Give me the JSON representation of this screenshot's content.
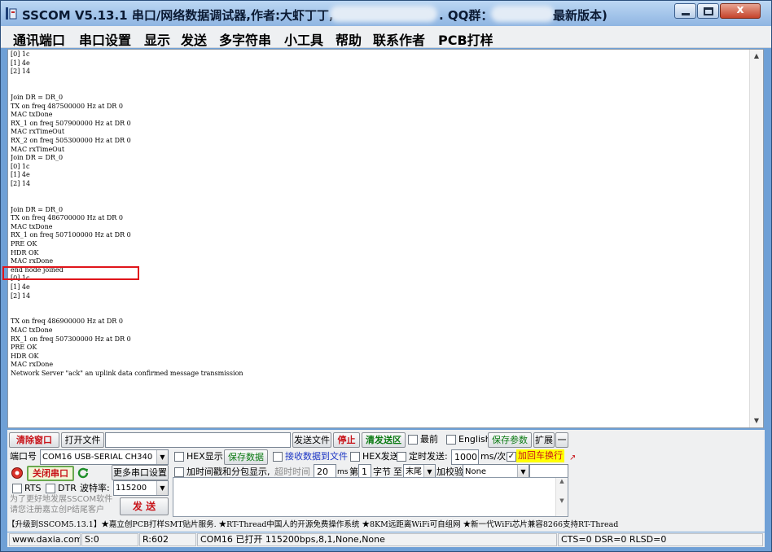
{
  "window": {
    "title": "SSCOM V5.13.1 串口/网络数据调试器,作者:大虾丁丁,",
    "title_qq": ". QQ群：",
    "title_tail": "最新版本)",
    "close_glyph": "x"
  },
  "menu": [
    "通讯端口",
    "串口设置",
    "显示",
    "发送",
    "多字符串",
    "小工具",
    "帮助",
    "联系作者",
    "PCB打样"
  ],
  "receive_log": [
    "[0] 1c",
    "[1] 4e",
    "[2] 14",
    "",
    "",
    "Join DR = DR_0",
    "TX on freq 487500000 Hz at DR 0",
    "MAC txDone",
    "RX_1 on freq 507900000 Hz at DR 0",
    "MAC rxTimeOut",
    "RX_2 on freq 505300000 Hz at DR 0",
    "MAC rxTimeOut",
    "Join DR = DR_0",
    "[0] 1c",
    "[1] 4e",
    "[2] 14",
    "",
    "",
    "Join DR = DR_0",
    "TX on freq 486700000 Hz at DR 0",
    "MAC txDone",
    "RX_1 on freq 507100000 Hz at DR 0",
    "PRE OK",
    "HDR OK",
    "MAC rxDone",
    "end node joined",
    "[0] 1c",
    "[1] 4e",
    "[2] 14",
    "",
    "",
    "TX on freq 486900000 Hz at DR 0",
    "MAC txDone",
    "RX_1 on freq 507300000 Hz at DR 0",
    "PRE OK",
    "HDR OK",
    "MAC rxDone",
    "Network Server \"ack\" an uplink data confirmed message transmission"
  ],
  "toolbar": {
    "clear_window": "清除窗口",
    "open_file": "打开文件",
    "file_path": "",
    "send_file": "发送文件",
    "stop": "停止",
    "clear_send": "清发送区",
    "topmost": "最前",
    "english": "English",
    "save_params": "保存参数",
    "expand": "扩展",
    "collapse": "一"
  },
  "port": {
    "port_label": "端口号",
    "port_value": "COM16 USB-SERIAL CH340",
    "hex_display": "HEX显示",
    "save_data": "保存数据",
    "recv_to_file": "接收数据到文件",
    "hex_send": "HEX发送",
    "timed_send": "定时发送:",
    "interval_value": "1000",
    "interval_unit": "ms/次",
    "append_newline": "加回车换行",
    "close_port": "关闭串口",
    "more_ports": "更多串口设置",
    "timestamp_split": "加时间戳和分包显示,",
    "timeout_label": "超时时间",
    "timeout_value": "20",
    "timeout_unit": "ms",
    "byte_prefix": "第",
    "byte_index": "1",
    "byte_label": "字节",
    "to_label": "至",
    "to_value": "末尾",
    "checksum_label": "加校验",
    "checksum_value": "None",
    "rts": "RTS",
    "dtr": "DTR",
    "baud_label": "波特率:",
    "baud_value": "115200",
    "promo_line1": "为了更好地发展SSCOM软件",
    "promo_line2": "请您注册嘉立创P结尾客户",
    "send": "发 送",
    "send_text": ""
  },
  "adbar": "【升级到SSCOM5.13.1】★嘉立创PCB打样SMT贴片服务. ★RT-Thread中国人的开源免费操作系统 ★8KM远距离WiFi可自组网 ★新一代WiFi芯片兼容8266支持RT-Thread",
  "status": {
    "website": "www.daxia.com",
    "sent": "S:0",
    "received": "R:602",
    "port_info": "COM16 已打开  115200bps,8,1,None,None",
    "signals": "CTS=0 DSR=0 RLSD=0"
  },
  "colors": {
    "highlight_box": "#e0161b",
    "accent_red": "#c8141a",
    "accent_green": "#0a7a12",
    "accent_blue": "#1b35c4",
    "newline_highlight": "#ffff00"
  }
}
